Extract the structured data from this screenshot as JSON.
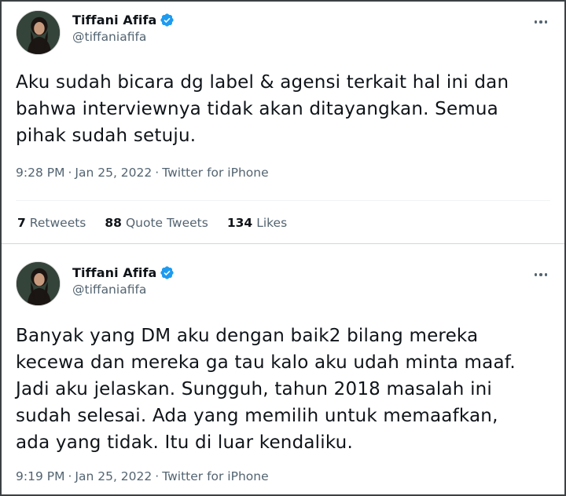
{
  "colors": {
    "text": "#0f1419",
    "secondary": "#536471",
    "verified": "#1d9bf0",
    "border": "#cfd9de"
  },
  "tweets": [
    {
      "author": {
        "display_name": "Tiffani Afifa",
        "handle": "@tiffaniafifa",
        "verified_icon": "verified-badge-icon"
      },
      "text": "Aku sudah bicara dg label & agensi terkait hal ini dan\nbahwa interviewnya tidak akan ditayangkan. Semua\npihak sudah setuju.",
      "time": "9:28 PM",
      "date": "Jan 25, 2022",
      "source": "Twitter for iPhone",
      "separator": "·",
      "stats": {
        "retweets_count": "7",
        "retweets_label": "Retweets",
        "quote_tweets_count": "88",
        "quote_tweets_label": "Quote Tweets",
        "likes_count": "134",
        "likes_label": "Likes"
      }
    },
    {
      "author": {
        "display_name": "Tiffani Afifa",
        "handle": "@tiffaniafifa",
        "verified_icon": "verified-badge-icon"
      },
      "text": "Banyak yang DM aku dengan baik2 bilang mereka\nkecewa dan mereka ga tau kalo aku udah minta maaf.\nJadi aku jelaskan. Sungguh, tahun 2018 masalah ini\nsudah selesai. Ada yang memilih untuk memaafkan,\nada yang tidak. Itu di luar kendaliku.",
      "time": "9:19 PM",
      "date": "Jan 25, 2022",
      "source": "Twitter for iPhone",
      "separator": "·"
    }
  ]
}
